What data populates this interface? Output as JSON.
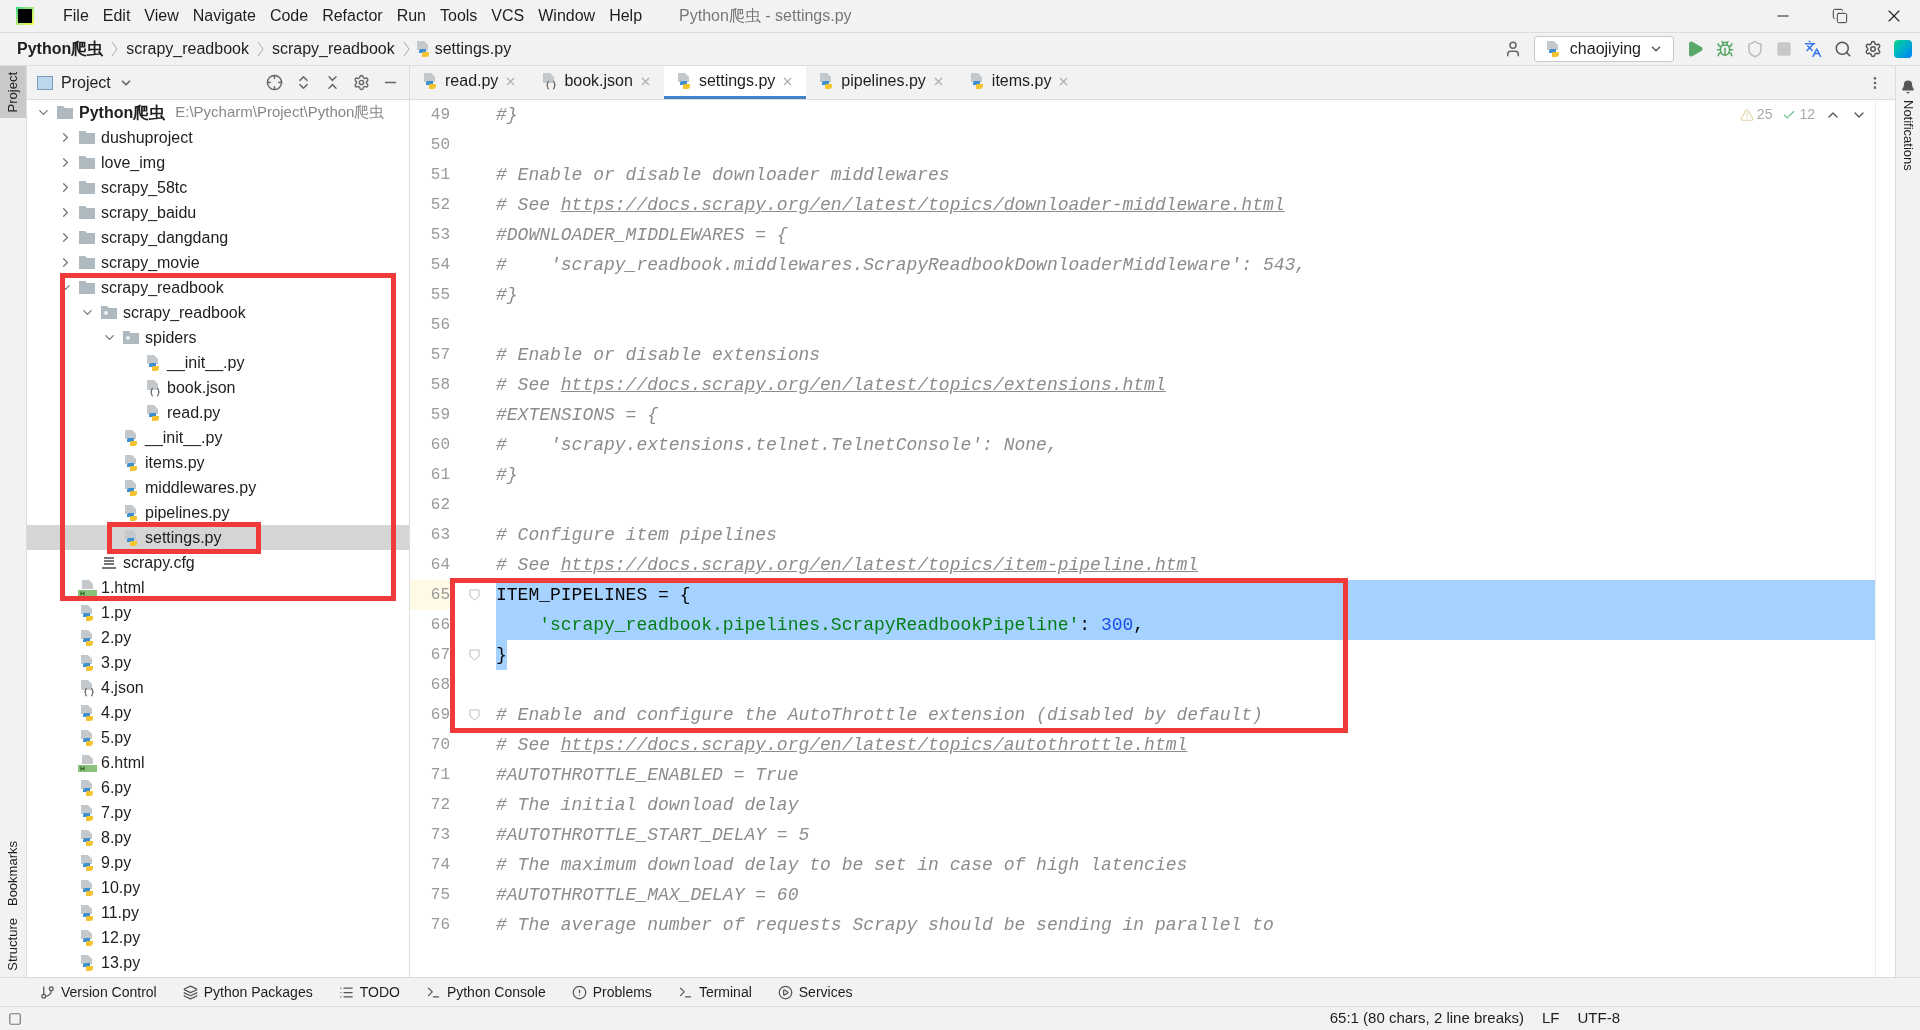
{
  "window": {
    "title": "Python爬虫 - settings.py"
  },
  "menu": [
    "File",
    "Edit",
    "View",
    "Navigate",
    "Code",
    "Refactor",
    "Run",
    "Tools",
    "VCS",
    "Window",
    "Help"
  ],
  "breadcrumbs": [
    {
      "label": "Python爬虫",
      "kind": "project"
    },
    {
      "label": "scrapy_readbook",
      "kind": "folder"
    },
    {
      "label": "scrapy_readbook",
      "kind": "folder"
    },
    {
      "label": "settings.py",
      "kind": "python"
    }
  ],
  "run_config": {
    "label": "chaojiying"
  },
  "left_stripe": [
    {
      "label": "Project",
      "selected": true
    },
    {
      "label": "Bookmarks",
      "selected": false
    },
    {
      "label": "Structure",
      "selected": false
    }
  ],
  "right_stripe": [
    {
      "label": "Notifications"
    }
  ],
  "project_panel": {
    "title": "Project"
  },
  "tree": {
    "name": "Python爬虫",
    "path": "E:\\Pycharm\\Project\\Python爬虫",
    "kind": "folder",
    "expanded": true,
    "selected": false,
    "children": [
      {
        "name": "dushuproject",
        "kind": "folder",
        "expanded": false,
        "selected": false
      },
      {
        "name": "love_img",
        "kind": "folder",
        "expanded": false,
        "selected": false
      },
      {
        "name": "scrapy_58tc",
        "kind": "folder",
        "expanded": false,
        "selected": false
      },
      {
        "name": "scrapy_baidu",
        "kind": "folder",
        "expanded": false,
        "selected": false
      },
      {
        "name": "scrapy_dangdang",
        "kind": "folder",
        "expanded": false,
        "selected": false
      },
      {
        "name": "scrapy_movie",
        "kind": "folder",
        "expanded": false,
        "selected": false
      },
      {
        "name": "scrapy_readbook",
        "kind": "folder",
        "expanded": true,
        "selected": false,
        "children": [
          {
            "name": "scrapy_readbook",
            "kind": "package",
            "expanded": true,
            "selected": false,
            "children": [
              {
                "name": "spiders",
                "kind": "package",
                "expanded": true,
                "selected": false,
                "children": [
                  {
                    "name": "__init__.py",
                    "kind": "python",
                    "selected": false
                  },
                  {
                    "name": "book.json",
                    "kind": "json",
                    "selected": false
                  },
                  {
                    "name": "read.py",
                    "kind": "python",
                    "selected": false
                  }
                ]
              },
              {
                "name": "__init__.py",
                "kind": "python",
                "selected": false
              },
              {
                "name": "items.py",
                "kind": "python",
                "selected": false
              },
              {
                "name": "middlewares.py",
                "kind": "python",
                "selected": false
              },
              {
                "name": "pipelines.py",
                "kind": "python",
                "selected": false
              },
              {
                "name": "settings.py",
                "kind": "python",
                "selected": true
              }
            ]
          },
          {
            "name": "scrapy.cfg",
            "kind": "cfg",
            "selected": false
          }
        ]
      },
      {
        "name": "1.html",
        "kind": "html",
        "selected": false
      },
      {
        "name": "1.py",
        "kind": "python",
        "selected": false
      },
      {
        "name": "2.py",
        "kind": "python",
        "selected": false
      },
      {
        "name": "3.py",
        "kind": "python",
        "selected": false
      },
      {
        "name": "4.json",
        "kind": "json",
        "selected": false
      },
      {
        "name": "4.py",
        "kind": "python",
        "selected": false
      },
      {
        "name": "5.py",
        "kind": "python",
        "selected": false
      },
      {
        "name": "6.html",
        "kind": "html",
        "selected": false
      },
      {
        "name": "6.py",
        "kind": "python",
        "selected": false
      },
      {
        "name": "7.py",
        "kind": "python",
        "selected": false
      },
      {
        "name": "8.py",
        "kind": "python",
        "selected": false
      },
      {
        "name": "9.py",
        "kind": "python",
        "selected": false
      },
      {
        "name": "10.py",
        "kind": "python",
        "selected": false
      },
      {
        "name": "11.py",
        "kind": "python",
        "selected": false
      },
      {
        "name": "12.py",
        "kind": "python",
        "selected": false
      },
      {
        "name": "13.py",
        "kind": "python",
        "selected": false
      }
    ]
  },
  "tabs": [
    {
      "label": "read.py",
      "kind": "python",
      "selected": false
    },
    {
      "label": "book.json",
      "kind": "json",
      "selected": false
    },
    {
      "label": "settings.py",
      "kind": "python",
      "selected": true
    },
    {
      "label": "pipelines.py",
      "kind": "python",
      "selected": false
    },
    {
      "label": "items.py",
      "kind": "python",
      "selected": false
    }
  ],
  "inspections": {
    "warnings": "25",
    "weak_warnings": "12"
  },
  "editor": {
    "lines": [
      {
        "number": "49",
        "fold": false,
        "segments": [
          {
            "kind": "comment",
            "text": "#}"
          }
        ]
      },
      {
        "number": "50",
        "fold": false
      },
      {
        "number": "51",
        "fold": false,
        "segments": [
          {
            "kind": "comment",
            "text": "# Enable or disable downloader middlewares"
          }
        ]
      },
      {
        "number": "52",
        "fold": false,
        "segments": [
          {
            "kind": "comment",
            "text": "# See "
          },
          {
            "kind": "url",
            "text": "https://docs.scrapy.org/en/latest/topics/downloader-middleware.html"
          }
        ]
      },
      {
        "number": "53",
        "fold": false,
        "segments": [
          {
            "kind": "comment",
            "text": "#DOWNLOADER_MIDDLEWARES = {"
          }
        ]
      },
      {
        "number": "54",
        "fold": false,
        "segments": [
          {
            "kind": "comment",
            "text": "#    'scrapy_readbook.middlewares.ScrapyReadbookDownloaderMiddleware': 543,"
          }
        ]
      },
      {
        "number": "55",
        "fold": false,
        "segments": [
          {
            "kind": "comment",
            "text": "#}"
          }
        ]
      },
      {
        "number": "56",
        "fold": false
      },
      {
        "number": "57",
        "fold": false,
        "segments": [
          {
            "kind": "comment",
            "text": "# Enable or disable extensions"
          }
        ]
      },
      {
        "number": "58",
        "fold": false,
        "segments": [
          {
            "kind": "comment",
            "text": "# See "
          },
          {
            "kind": "url",
            "text": "https://docs.scrapy.org/en/latest/topics/extensions.html"
          }
        ]
      },
      {
        "number": "59",
        "fold": false,
        "segments": [
          {
            "kind": "comment",
            "text": "#EXTENSIONS = {"
          }
        ]
      },
      {
        "number": "60",
        "fold": false,
        "segments": [
          {
            "kind": "comment",
            "text": "#    'scrapy.extensions.telnet.TelnetConsole': None,"
          }
        ]
      },
      {
        "number": "61",
        "fold": false,
        "segments": [
          {
            "kind": "comment",
            "text": "#}"
          }
        ]
      },
      {
        "number": "62",
        "fold": false
      },
      {
        "number": "63",
        "fold": false,
        "segments": [
          {
            "kind": "comment",
            "text": "# Configure item pipelines"
          }
        ]
      },
      {
        "number": "64",
        "fold": false,
        "segments": [
          {
            "kind": "comment",
            "text": "# See "
          },
          {
            "kind": "url",
            "text": "https://docs.scrapy.org/en/latest/topics/item-pipeline.html"
          }
        ]
      },
      {
        "number": "65",
        "selected": true,
        "current": true,
        "fold": true,
        "segments": [
          {
            "kind": "plain",
            "text": "ITEM_PIPELINES = {"
          }
        ]
      },
      {
        "number": "66",
        "selected": true,
        "fold": false,
        "segments": [
          {
            "kind": "string",
            "text": "    'scrapy_readbook.pipelines.ScrapyReadbookPipeline'"
          },
          {
            "kind": "plain",
            "text": ": "
          },
          {
            "kind": "number",
            "text": "300"
          },
          {
            "kind": "plain",
            "text": ","
          }
        ]
      },
      {
        "number": "67",
        "selected": true,
        "partial": true,
        "fold": true,
        "segments": [
          {
            "kind": "plain",
            "text": "}"
          }
        ]
      },
      {
        "number": "68",
        "fold": false
      },
      {
        "number": "69",
        "fold": true,
        "segments": [
          {
            "kind": "comment",
            "text": "# Enable and configure the AutoThrottle extension (disabled by default)"
          }
        ]
      },
      {
        "number": "70",
        "fold": false,
        "segments": [
          {
            "kind": "comment",
            "text": "# See "
          },
          {
            "kind": "url",
            "text": "https://docs.scrapy.org/en/latest/topics/autothrottle.html"
          }
        ]
      },
      {
        "number": "71",
        "fold": false,
        "segments": [
          {
            "kind": "comment",
            "text": "#AUTOTHROTTLE_ENABLED = True"
          }
        ]
      },
      {
        "number": "72",
        "fold": false,
        "segments": [
          {
            "kind": "comment",
            "text": "# The initial download delay"
          }
        ]
      },
      {
        "number": "73",
        "fold": false,
        "segments": [
          {
            "kind": "comment",
            "text": "#AUTOTHROTTLE_START_DELAY = 5"
          }
        ]
      },
      {
        "number": "74",
        "fold": false,
        "segments": [
          {
            "kind": "comment",
            "text": "# The maximum download delay to be set in case of high latencies"
          }
        ]
      },
      {
        "number": "75",
        "fold": false,
        "segments": [
          {
            "kind": "comment",
            "text": "#AUTOTHROTTLE_MAX_DELAY = 60"
          }
        ]
      },
      {
        "number": "76",
        "fold": false,
        "segments": [
          {
            "kind": "comment",
            "text": "# The average number of requests Scrapy should be sending in parallel to"
          }
        ]
      }
    ]
  },
  "annotations": [
    {
      "kind": "tree-frame"
    },
    {
      "kind": "tree-item-frame"
    },
    {
      "kind": "editor-frame"
    }
  ],
  "tool_windows": [
    {
      "label": "Version Control",
      "kind": "vcs"
    },
    {
      "label": "Python Packages",
      "kind": "packages"
    },
    {
      "label": "TODO",
      "kind": "todo"
    },
    {
      "label": "Python Console",
      "kind": "console"
    },
    {
      "label": "Problems",
      "kind": "problems"
    },
    {
      "label": "Terminal",
      "kind": "terminal"
    },
    {
      "label": "Services",
      "kind": "services"
    }
  ],
  "status_bar": {
    "position": "65:1 (80 chars, 2 line breaks)",
    "line_separator": "LF",
    "encoding": "UTF-8"
  }
}
